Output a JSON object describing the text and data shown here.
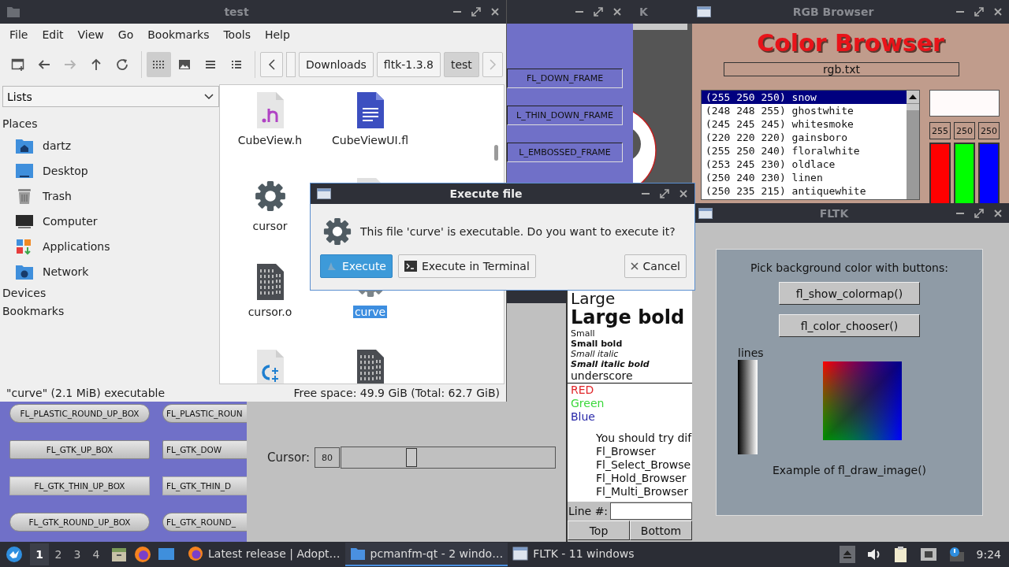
{
  "file_manager": {
    "title": "test",
    "active": false,
    "menu": [
      "File",
      "Edit",
      "View",
      "Go",
      "Bookmarks",
      "Tools",
      "Help"
    ],
    "nav": [
      {
        "kind": "new-tab",
        "disabled": false
      },
      {
        "kind": "back",
        "disabled": false
      },
      {
        "kind": "forward",
        "disabled": true
      },
      {
        "kind": "up",
        "disabled": false
      },
      {
        "kind": "reload",
        "disabled": false
      }
    ],
    "view_modes": [
      {
        "kind": "icons",
        "selected": true
      },
      {
        "kind": "thumbnails",
        "selected": false
      },
      {
        "kind": "compact",
        "selected": false
      },
      {
        "kind": "details",
        "selected": false
      }
    ],
    "breadcrumbs": [
      {
        "label": "Downloads",
        "selected": false
      },
      {
        "label": "fltk-1.3.8",
        "selected": false
      },
      {
        "label": "test",
        "selected": true
      }
    ],
    "side_mode": "Lists",
    "places_heading": "Places",
    "places": [
      {
        "label": "dartz",
        "kind": "home"
      },
      {
        "label": "Desktop",
        "kind": "desktop"
      },
      {
        "label": "Trash",
        "kind": "trash"
      },
      {
        "label": "Computer",
        "kind": "computer"
      },
      {
        "label": "Applications",
        "kind": "applications"
      },
      {
        "label": "Network",
        "kind": "network"
      }
    ],
    "headings": [
      "Devices",
      "Bookmarks"
    ],
    "files": [
      {
        "name": "CubeView.h",
        "kind": "header",
        "selected": false
      },
      {
        "name": "CubeViewUI.fl",
        "kind": "document",
        "selected": false
      },
      {
        "name": "cursor",
        "kind": "gear",
        "selected": false
      },
      {
        "kind": "file"
      },
      {
        "name": "cursor.o",
        "kind": "binary",
        "selected": false
      },
      {
        "name": "curve",
        "kind": "gear",
        "selected": true
      },
      {
        "kind": "cpp",
        "selected": false
      },
      {
        "kind": "binary",
        "selected": false
      }
    ],
    "status_left": "\"curve\" (2.1 MiB) executable",
    "status_right": "Free space: 49.9 GiB (Total: 62.7 GiB)"
  },
  "dialog": {
    "title": "Execute file",
    "active": true,
    "message": "This file 'curve' is executable. Do you want to execute it?",
    "buttons": [
      {
        "label": "Execute",
        "kind": "execute",
        "focused": true
      },
      {
        "label": "Execute in Terminal",
        "kind": "terminal",
        "focused": false
      },
      {
        "label": "Cancel",
        "kind": "cancel",
        "focused": false
      }
    ]
  },
  "box_window": {
    "frames": [
      "FL_DOWN_FRAME",
      "L_THIN_DOWN_FRAME",
      "L_EMBOSSED_FRAME"
    ],
    "boxes": [
      {
        "label": "FL_PLASTIC_ROUND_UP_BOX",
        "kind": "round"
      },
      {
        "label": "FL_PLASTIC_ROUN",
        "kind": "round"
      },
      {
        "label": "FL_GTK_UP_BOX",
        "kind": "flat"
      },
      {
        "label": "FL_GTK_DOW",
        "kind": "flat"
      },
      {
        "label": "FL_GTK_THIN_UP_BOX",
        "kind": "thin"
      },
      {
        "label": "FL_GTK_THIN_D",
        "kind": "thin"
      },
      {
        "label": "FL_GTK_ROUND_UP_BOX",
        "kind": "round"
      },
      {
        "label": "FL_GTK_ROUND_",
        "kind": "round"
      }
    ]
  },
  "k_window": {
    "title": "K",
    "active": false
  },
  "rgb_browser": {
    "title": "RGB Browser",
    "active": false,
    "heading": "Color Browser",
    "file": "rgb.txt",
    "colors": [
      {
        "text": "(255 250 250) snow",
        "selected": true
      },
      {
        "text": "(248 248 255) ghostwhite",
        "selected": false
      },
      {
        "text": "(245 245 245) whitesmoke",
        "selected": false
      },
      {
        "text": "(220 220 220) gainsboro",
        "selected": false
      },
      {
        "text": "(255 250 240) floralwhite",
        "selected": false
      },
      {
        "text": "(253 245 230) oldlace",
        "selected": false
      },
      {
        "text": "(250 240 230) linen",
        "selected": false
      },
      {
        "text": "(250 235 215) antiquewhite",
        "selected": false
      }
    ],
    "values": [
      "255",
      "250",
      "250"
    ]
  },
  "fltk_window": {
    "title": "FLTK",
    "active": false,
    "prompt": "Pick background color with buttons:",
    "buttons": [
      "fl_show_colormap()",
      "fl_color_chooser()"
    ],
    "lines_label": "lines",
    "caption": "Example of fl_draw_image()"
  },
  "text_browser": {
    "lines": [
      {
        "text": "Large",
        "kind": "large"
      },
      {
        "text": "Large bold",
        "kind": "large-bold"
      },
      {
        "text": "Small",
        "kind": "small"
      },
      {
        "text": "Small bold",
        "kind": "small-bold"
      },
      {
        "text": "Small italic",
        "kind": "small-italic"
      },
      {
        "text": "Small italic bold",
        "kind": "small-italic-bold"
      },
      {
        "text": "underscore",
        "kind": "underscore"
      },
      {
        "text": "RED",
        "kind": "colored",
        "color": "#e0262a"
      },
      {
        "text": "Green",
        "kind": "colored",
        "color": "#3ad83a"
      },
      {
        "text": "Blue",
        "kind": "colored",
        "color": "#2626a8"
      },
      {
        "text": "You should try dif",
        "kind": "paragraph"
      },
      {
        "text": "Fl_Browser",
        "kind": "indented"
      },
      {
        "text": "Fl_Select_Browse",
        "kind": "indented"
      },
      {
        "text": "Fl_Hold_Browser",
        "kind": "indented"
      },
      {
        "text": "Fl_Multi_Browser",
        "kind": "indented"
      }
    ],
    "line_label": "Line #:",
    "buttons": [
      "Top",
      "Bottom"
    ]
  },
  "cursor_window": {
    "label": "Cursor:",
    "value": "80",
    "level": 0.32
  },
  "taskbar": {
    "workspaces": [
      {
        "label": "1",
        "selected": true
      },
      {
        "label": "2",
        "selected": false
      },
      {
        "label": "3",
        "selected": false
      },
      {
        "label": "4",
        "selected": false
      }
    ],
    "tasks": [
      {
        "label": "Latest release | Adopt…",
        "kind": "browser",
        "selected": false
      },
      {
        "label": "pcmanfm-qt - 2 windo…",
        "kind": "folder",
        "selected": true
      },
      {
        "label": "FLTK - 11 windows",
        "kind": "window",
        "selected": false
      }
    ],
    "clock": "9:24"
  }
}
